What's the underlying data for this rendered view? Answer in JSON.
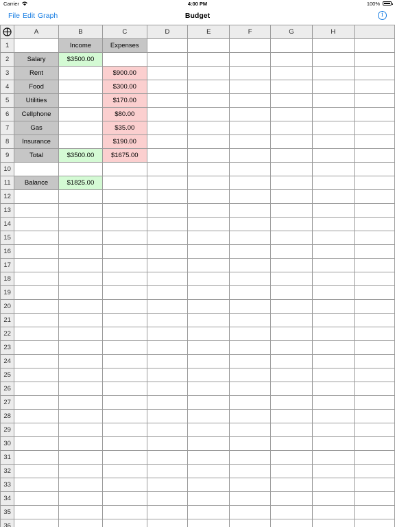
{
  "status_bar": {
    "carrier": "Carrier",
    "time": "4:00 PM",
    "battery": "100%"
  },
  "nav": {
    "menus": [
      "File",
      "Edit",
      "Graph"
    ],
    "title": "Budget"
  },
  "sheet": {
    "columns": [
      "A",
      "B",
      "C",
      "D",
      "E",
      "F",
      "G",
      "H",
      ""
    ],
    "row_count": 36,
    "cells": {
      "1": {
        "B": [
          "Income",
          "hdr"
        ],
        "C": [
          "Expenses",
          "hdr"
        ]
      },
      "2": {
        "A": [
          "Salary",
          "hdr"
        ],
        "B": [
          "$3500.00",
          "inc"
        ]
      },
      "3": {
        "A": [
          "Rent",
          "hdr"
        ],
        "C": [
          "$900.00",
          "exp"
        ]
      },
      "4": {
        "A": [
          "Food",
          "hdr"
        ],
        "C": [
          "$300.00",
          "exp"
        ]
      },
      "5": {
        "A": [
          "Utilities",
          "hdr"
        ],
        "C": [
          "$170.00",
          "exp"
        ]
      },
      "6": {
        "A": [
          "Cellphone",
          "hdr"
        ],
        "C": [
          "$80.00",
          "exp"
        ]
      },
      "7": {
        "A": [
          "Gas",
          "hdr"
        ],
        "C": [
          "$35.00",
          "exp"
        ]
      },
      "8": {
        "A": [
          "Insurance",
          "hdr"
        ],
        "C": [
          "$190.00",
          "exp"
        ]
      },
      "9": {
        "A": [
          "Total",
          "hdr"
        ],
        "B": [
          "$3500.00",
          "inc"
        ],
        "C": [
          "$1675.00",
          "exp"
        ]
      },
      "11": {
        "A": [
          "Balance",
          "hdr"
        ],
        "B": [
          "$1825.00",
          "inc"
        ]
      }
    }
  },
  "colors": {
    "accent": "#1b7fe3",
    "header_fill": "#c6c6c6",
    "income_fill": "#d4fad4",
    "expense_fill": "#fbcfcf"
  },
  "icons": {
    "corner": "crosshair-icon",
    "info": "info-icon",
    "wifi": "wifi-icon",
    "battery": "battery-icon"
  }
}
